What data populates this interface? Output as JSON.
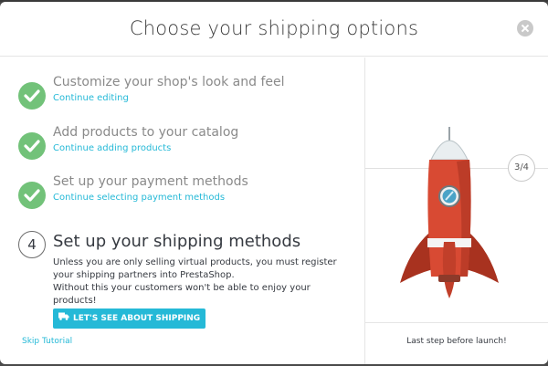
{
  "modal": {
    "title": "Choose your shipping options",
    "close_icon": "close-icon"
  },
  "steps": [
    {
      "title": "Customize your shop's look and feel",
      "link": "Continue editing",
      "status": "done"
    },
    {
      "title": "Add products to your catalog",
      "link": "Continue adding products",
      "status": "done"
    },
    {
      "title": "Set up your payment methods",
      "link": "Continue selecting payment methods",
      "status": "done"
    }
  ],
  "current_step": {
    "number": "4",
    "title": "Set up your shipping methods",
    "description_line1": "Unless you are only selling virtual products, you must register your shipping partners into PrestaShop.",
    "description_line2": "Without this your customers won't be able to enjoy your products!",
    "button_label": "LET'S SEE ABOUT SHIPPING",
    "button_icon": "truck-icon"
  },
  "skip_label": "Skip Tutorial",
  "progress": {
    "counter": "3/4",
    "footer_text": "Last step before launch!"
  },
  "colors": {
    "accent": "#25b9d7",
    "done_green": "#72c279",
    "rocket_red": "#d84a33"
  }
}
